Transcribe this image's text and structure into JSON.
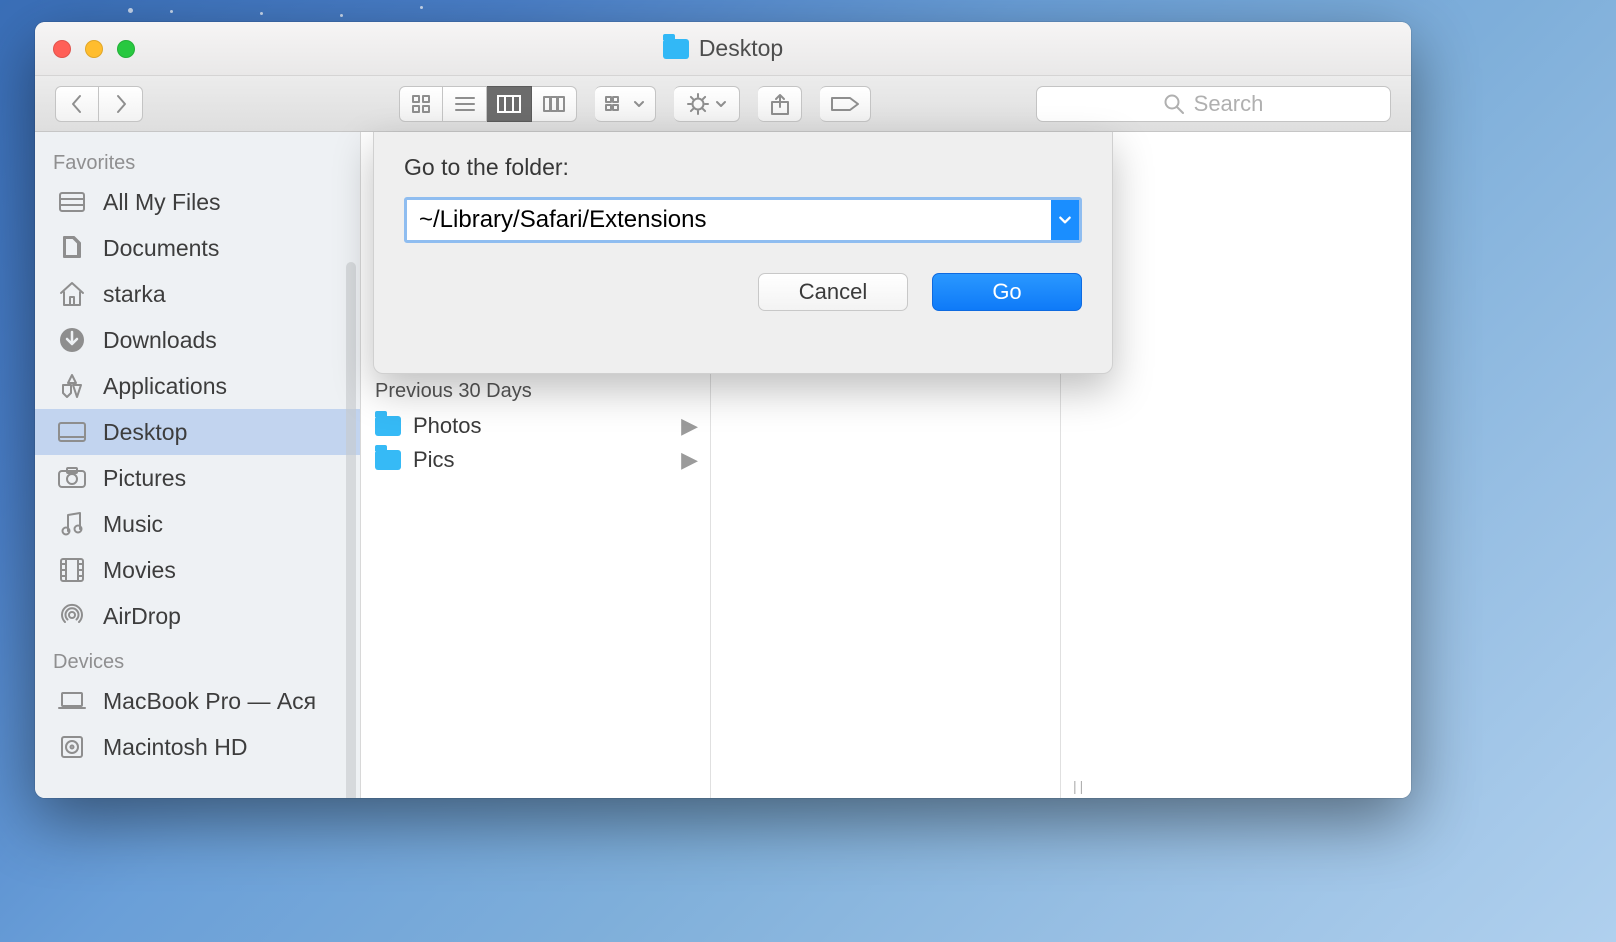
{
  "window": {
    "title": "Desktop"
  },
  "toolbar": {
    "search_placeholder": "Search"
  },
  "sidebar": {
    "sections": [
      {
        "label": "Favorites",
        "items": [
          {
            "label": "All My Files"
          },
          {
            "label": "Documents"
          },
          {
            "label": "starka"
          },
          {
            "label": "Downloads"
          },
          {
            "label": "Applications"
          },
          {
            "label": "Desktop",
            "selected": true
          },
          {
            "label": "Pictures"
          },
          {
            "label": "Music"
          },
          {
            "label": "Movies"
          },
          {
            "label": "AirDrop"
          }
        ]
      },
      {
        "label": "Devices",
        "items": [
          {
            "label": "MacBook Pro — Ася"
          },
          {
            "label": "Macintosh HD"
          }
        ]
      }
    ]
  },
  "content": {
    "group_header": "Previous 30 Days",
    "rows": [
      {
        "name": "Photos"
      },
      {
        "name": "Pics"
      }
    ]
  },
  "sheet": {
    "title": "Go to the folder:",
    "path_value": "~/Library/Safari/Extensions",
    "cancel": "Cancel",
    "go": "Go"
  }
}
